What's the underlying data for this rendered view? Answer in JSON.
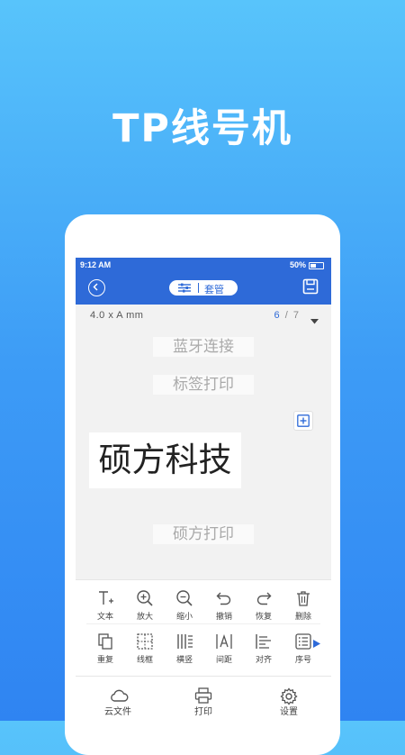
{
  "hero": {
    "title": "TP线号机"
  },
  "status_bar": {
    "time": "9:12 AM",
    "battery": "50%"
  },
  "navbar": {
    "mode_label": "套管"
  },
  "label_info": {
    "size_text": "4.0  x  A   mm",
    "current_page": "6",
    "separator": "/",
    "total_pages": "7"
  },
  "canvas": {
    "ghost_1": "蓝牙连接",
    "ghost_2": "标签打印",
    "main_text": "硕方科技",
    "ghost_3": "硕方打印"
  },
  "toolbar": {
    "row1": [
      {
        "label": "文本",
        "icon": "text-add-icon"
      },
      {
        "label": "放大",
        "icon": "zoom-in-icon"
      },
      {
        "label": "缩小",
        "icon": "zoom-out-icon"
      },
      {
        "label": "撤销",
        "icon": "undo-icon"
      },
      {
        "label": "恢复",
        "icon": "redo-icon"
      },
      {
        "label": "删除",
        "icon": "trash-icon"
      }
    ],
    "row2": [
      {
        "label": "重复",
        "icon": "duplicate-icon"
      },
      {
        "label": "线框",
        "icon": "frame-icon"
      },
      {
        "label": "横竖",
        "icon": "orientation-icon"
      },
      {
        "label": "间距",
        "icon": "spacing-icon"
      },
      {
        "label": "对齐",
        "icon": "align-icon"
      },
      {
        "label": "序号",
        "icon": "serial-number-icon"
      }
    ]
  },
  "bottom_nav": [
    {
      "label": "云文件",
      "icon": "cloud-icon"
    },
    {
      "label": "打印",
      "icon": "printer-icon"
    },
    {
      "label": "设置",
      "icon": "gear-icon"
    }
  ],
  "colors": {
    "brand_blue": "#2e6ad8",
    "background_top": "#58c4fb",
    "background_bottom": "#2f84f2"
  }
}
